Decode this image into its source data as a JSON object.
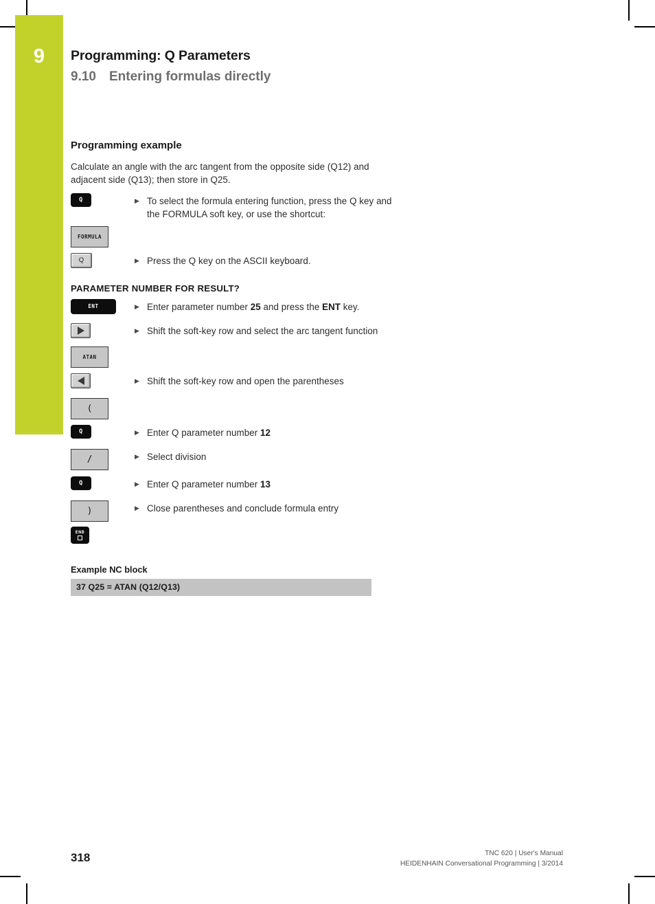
{
  "crop_marks": {
    "visible": true
  },
  "chapter_tab": {
    "number": "9",
    "color": "#c3d22a"
  },
  "header": {
    "chapter_title": "Programming: Q Parameters",
    "section_number": "9.10",
    "section_title": "Entering formulas directly"
  },
  "content": {
    "subheading": "Programming example",
    "intro": "Calculate an angle with the arc tangent from the opposite side (Q12) and adjacent side (Q13); then store in Q25.",
    "query_heading": "PARAMETER NUMBER FOR RESULT?",
    "steps": [
      {
        "key_type": "hard-q",
        "key_label": "Q",
        "text_before": "To select the formula entering function, press the Q key and the FORMULA soft key, or use the shortcut:",
        "bold": "",
        "text_after": ""
      },
      {
        "key_type": "soft",
        "key_label": "FORMULA",
        "text_before": "",
        "bold": "",
        "text_after": ""
      },
      {
        "key_type": "ascii",
        "key_label": "Q",
        "text_before": "Press the Q key on the ASCII keyboard.",
        "bold": "",
        "text_after": ""
      },
      {
        "key_type": "hard-ent",
        "key_label": "ENT",
        "text_before": "Enter parameter number ",
        "bold": "25",
        "text_after": " and press the "
      },
      {
        "key_type": "shift-right",
        "key_label": "▶",
        "text_before": "Shift the soft-key row and select the arc tangent function",
        "bold": "",
        "text_after": ""
      },
      {
        "key_type": "soft",
        "key_label": "ATAN",
        "text_before": "",
        "bold": "",
        "text_after": ""
      },
      {
        "key_type": "shift-left",
        "key_label": "◀",
        "text_before": "Shift the soft-key row and open the parentheses",
        "bold": "",
        "text_after": ""
      },
      {
        "key_type": "soft-glyph",
        "key_label": "(",
        "text_before": "",
        "bold": "",
        "text_after": ""
      },
      {
        "key_type": "hard-q",
        "key_label": "Q",
        "text_before": "Enter Q parameter number ",
        "bold": "12",
        "text_after": ""
      },
      {
        "key_type": "soft-glyph",
        "key_label": "/",
        "text_before": "Select division",
        "bold": "",
        "text_after": ""
      },
      {
        "key_type": "hard-q",
        "key_label": "Q",
        "text_before": "Enter Q parameter number ",
        "bold": "13",
        "text_after": ""
      },
      {
        "key_type": "soft-glyph",
        "key_label": ")",
        "text_before": "Close parentheses and conclude formula entry",
        "bold": "",
        "text_after": ""
      },
      {
        "key_type": "hard-end",
        "key_label": "END",
        "text_before": "",
        "bold": "",
        "text_after": ""
      }
    ],
    "step_texts": {
      "s1": "To select the formula entering function, press the Q key and the FORMULA soft key, or use the shortcut:",
      "s2": "Press the Q key on the ASCII keyboard.",
      "s3_a": "Enter parameter number ",
      "s3_b": "25",
      "s3_c": " and press the ",
      "s3_d": "ENT",
      "s3_e": " key.",
      "s4": "Shift the soft-key row and select the arc tangent function",
      "s5": "Shift the soft-key row and open the parentheses",
      "s6_a": "Enter Q parameter number ",
      "s6_b": "12",
      "s7": "Select division",
      "s8_a": "Enter Q parameter number ",
      "s8_b": "13",
      "s9": "Close parentheses and conclude formula entry"
    },
    "keys": {
      "q_hard": "Q",
      "formula": "FORMULA",
      "q_ascii": "Q",
      "ent": "ENT",
      "atan": "ATAN",
      "paren_open": "(",
      "divide": "/",
      "paren_close": ")",
      "end": "END"
    },
    "nc": {
      "heading": "Example NC block",
      "block": "37 Q25 = ATAN (Q12/Q13)"
    }
  },
  "footer": {
    "page_number": "318",
    "line1": "TNC 620 | User's Manual",
    "line2": "HEIDENHAIN Conversational Programming | 3/2014"
  }
}
